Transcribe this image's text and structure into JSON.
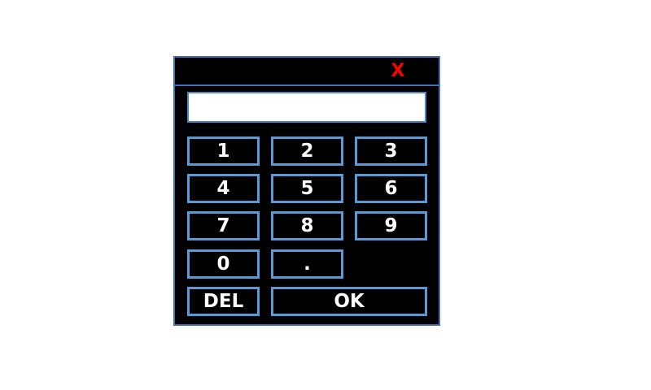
{
  "keypad": {
    "close_label": "X",
    "display_value": "",
    "keys": {
      "k1": "1",
      "k2": "2",
      "k3": "3",
      "k4": "4",
      "k5": "5",
      "k6": "6",
      "k7": "7",
      "k8": "8",
      "k9": "9",
      "k0": "0",
      "dot": ".",
      "del": "DEL",
      "ok": "OK"
    }
  },
  "colors": {
    "panel_background": "#000000",
    "panel_border": "#3f6fb4",
    "key_border": "#5b9bd5",
    "key_text": "#ffffff",
    "close_color": "#ff0000",
    "page_background": "#ffffff"
  }
}
